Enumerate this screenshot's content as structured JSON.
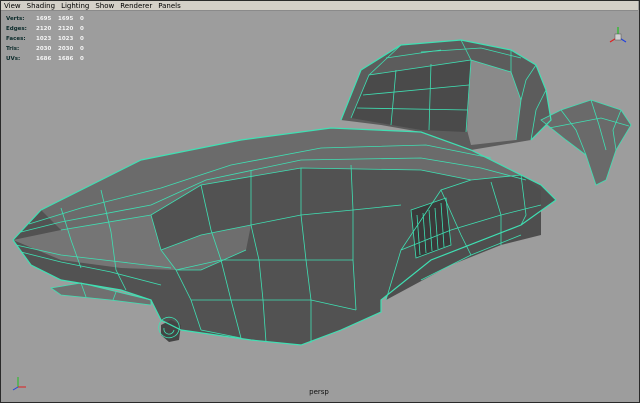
{
  "menu": [
    "View",
    "Shading",
    "Lighting",
    "Show",
    "Renderer",
    "Panels"
  ],
  "hud": [
    {
      "label": "Verts:",
      "v1": "1695",
      "v2": "1695",
      "v3": "0"
    },
    {
      "label": "Edges:",
      "v1": "2120",
      "v2": "2120",
      "v3": "0"
    },
    {
      "label": "Faces:",
      "v1": "1023",
      "v2": "1023",
      "v3": "0"
    },
    {
      "label": "Tris:",
      "v1": "2030",
      "v2": "2030",
      "v3": "0"
    },
    {
      "label": "UVs:",
      "v1": "1686",
      "v2": "1686",
      "v3": "0"
    }
  ],
  "camera_label": "persp",
  "view_cube_axes": {
    "x_color": "#e02020",
    "y_color": "#20c020",
    "z_color": "#2040e0"
  },
  "wire_color": "#3fe0b3",
  "viewport_bg": "#9d9d9d"
}
